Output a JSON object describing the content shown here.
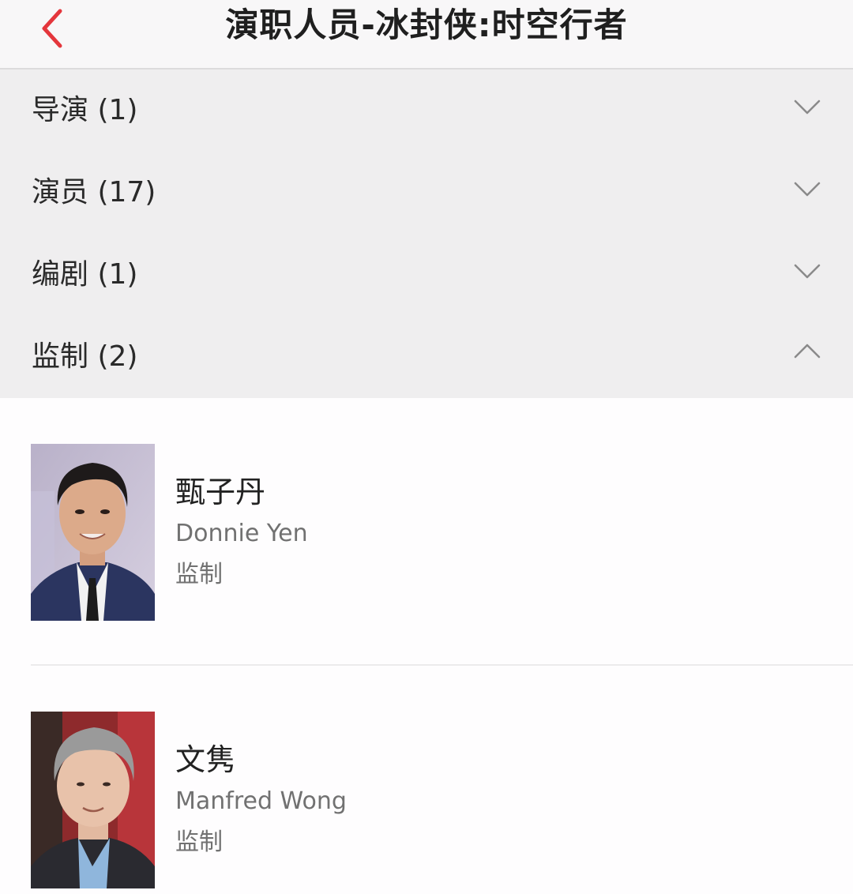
{
  "header": {
    "title": "演职人员-冰封侠:时空行者",
    "back_icon": "chevron-left-icon",
    "accent_color": "#e4363c"
  },
  "sections": [
    {
      "label": "导演 (1)",
      "expanded": false,
      "icon": "chevron-down-icon"
    },
    {
      "label": "演员 (17)",
      "expanded": false,
      "icon": "chevron-down-icon"
    },
    {
      "label": "编剧 (1)",
      "expanded": false,
      "icon": "chevron-down-icon"
    },
    {
      "label": "监制 (2)",
      "expanded": true,
      "icon": "chevron-up-icon"
    }
  ],
  "people": [
    {
      "name": "甄子丹",
      "name_en": "Donnie Yen",
      "role": "监制"
    },
    {
      "name": "文隽",
      "name_en": "Manfred Wong",
      "role": "监制"
    }
  ]
}
